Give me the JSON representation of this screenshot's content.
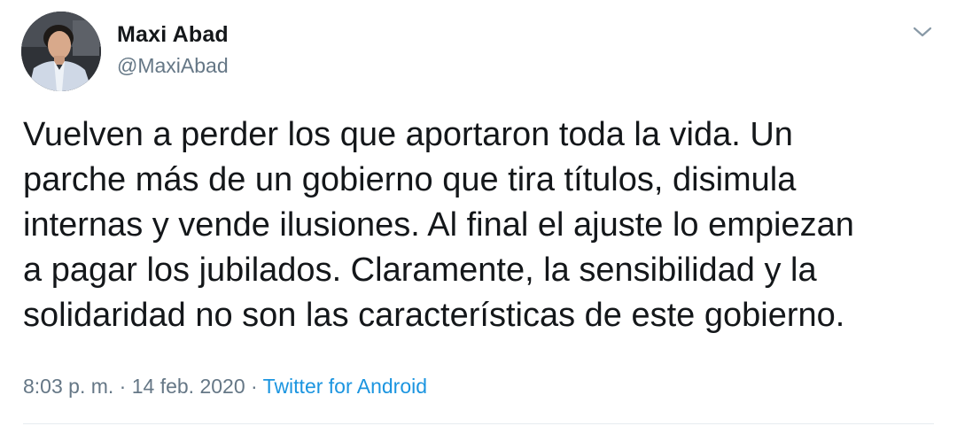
{
  "author": {
    "display_name": "Maxi Abad",
    "handle": "@MaxiAbad"
  },
  "tweet": {
    "lines": [
      "Vuelven a perder los que aportaron toda la vida. Un",
      "parche más de un gobierno que tira títulos, disimula",
      "internas y vende ilusiones. Al final el ajuste lo empiezan",
      "a pagar los jubilados. Claramente, la sensibilidad y la",
      "solidaridad no son las características de este gobierno."
    ]
  },
  "meta": {
    "time": "8:03 p. m.",
    "separator_1": " · ",
    "date": "14 feb. 2020",
    "separator_2": " · ",
    "source": "Twitter for Android"
  },
  "icons": {
    "avatar": "profile-photo",
    "caret": "chevron-down-icon"
  },
  "colors": {
    "text": "#14171a",
    "secondary": "#657786",
    "link": "#1b95e0",
    "divider": "#e6ecf0"
  }
}
